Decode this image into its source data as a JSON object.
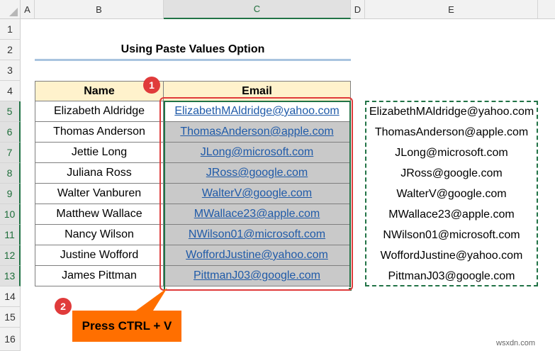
{
  "columns": [
    "A",
    "B",
    "C",
    "D",
    "E"
  ],
  "rows": [
    "1",
    "2",
    "3",
    "4",
    "5",
    "6",
    "7",
    "8",
    "9",
    "10",
    "11",
    "12",
    "13",
    "14",
    "15",
    "16"
  ],
  "title": "Using Paste Values Option",
  "table": {
    "headers": [
      "Name",
      "Email"
    ],
    "records": [
      {
        "name": "Elizabeth Aldridge",
        "email": "ElizabethMAldridge@yahoo.com"
      },
      {
        "name": "Thomas Anderson",
        "email": "ThomasAnderson@apple.com"
      },
      {
        "name": "Jettie Long",
        "email": "JLong@microsoft.com"
      },
      {
        "name": "Juliana Ross",
        "email": "JRoss@google.com"
      },
      {
        "name": "Walter Vanburen",
        "email": "WalterV@google.com"
      },
      {
        "name": "Matthew Wallace",
        "email": "MWallace23@apple.com"
      },
      {
        "name": "Nancy Wilson",
        "email": "NWilson01@microsoft.com"
      },
      {
        "name": "Justine Wofford",
        "email": "WoffordJustine@yahoo.com"
      },
      {
        "name": "James Pittman",
        "email": "PittmanJ03@google.com"
      }
    ]
  },
  "copied_values": [
    "ElizabethMAldridge@yahoo.com",
    "ThomasAnderson@apple.com",
    "JLong@microsoft.com",
    "JRoss@google.com",
    "WalterV@google.com",
    "MWallace23@apple.com",
    "NWilson01@microsoft.com",
    "WoffordJustine@yahoo.com",
    "PittmanJ03@google.com"
  ],
  "annotations": {
    "step1": "1",
    "step2": "2",
    "callout_text": "Press CTRL + V"
  },
  "watermark": "wsxdn.com",
  "colors": {
    "header_fill": "#fff2cc",
    "email_fill": "#c9c9c9",
    "link": "#1f5aa8",
    "marker_red": "#e03b3b",
    "callout_orange": "#ff6f00",
    "copy_border_green": "#217346"
  }
}
